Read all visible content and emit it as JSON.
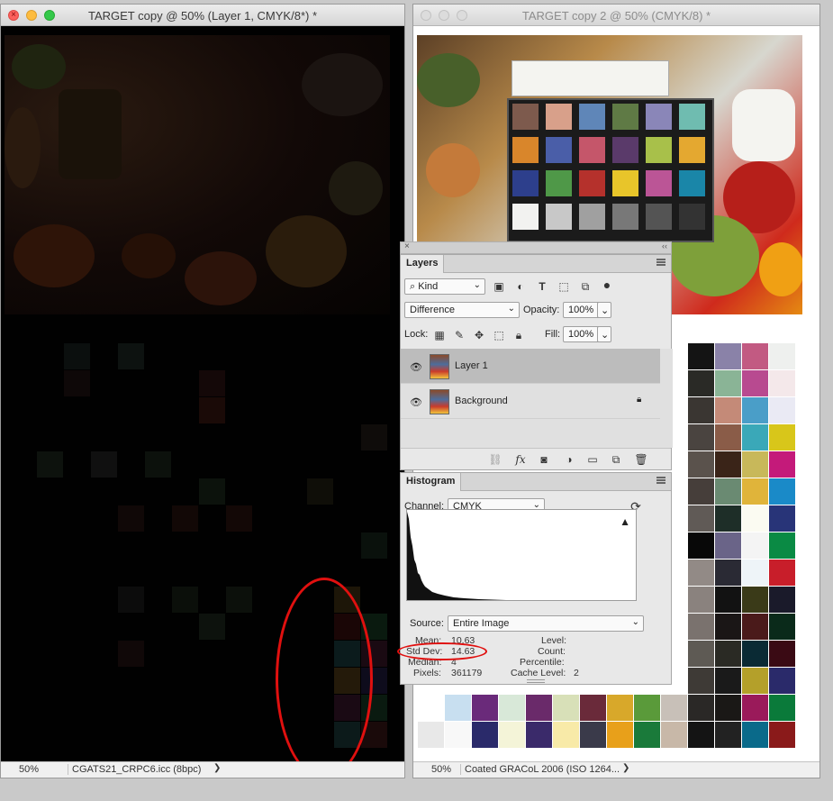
{
  "window1": {
    "title": "TARGET copy @ 50% (Layer 1, CMYK/8*) *",
    "zoom": "50%",
    "doc_info": "CGATS21_CRPC6.icc (8bpc)"
  },
  "window2": {
    "title": "TARGET copy 2 @ 50% (CMYK/8) *",
    "zoom": "50%",
    "doc_info": "Coated GRACoL 2006 (ISO 1264..."
  },
  "layers_panel": {
    "tab": "Layers",
    "kind_label": "Kind",
    "blend_mode": "Difference",
    "opacity_label": "Opacity:",
    "opacity_value": "100%",
    "lock_label": "Lock:",
    "fill_label": "Fill:",
    "fill_value": "100%",
    "layers": [
      {
        "name": "Layer 1",
        "selected": true,
        "locked": false
      },
      {
        "name": "Background",
        "selected": false,
        "locked": true
      }
    ],
    "fx_label": "fx"
  },
  "histogram_panel": {
    "tab": "Histogram",
    "channel_label": "Channel:",
    "channel_value": "CMYK",
    "source_label": "Source:",
    "source_value": "Entire Image",
    "stats": {
      "mean_label": "Mean:",
      "mean": "10.63",
      "stddev_label": "Std Dev:",
      "stddev": "14.63",
      "median_label": "Median:",
      "median": "4",
      "pixels_label": "Pixels:",
      "pixels": "361179",
      "level_label": "Level:",
      "count_label": "Count:",
      "percentile_label": "Percentile:",
      "cache_label": "Cache Level:",
      "cache": "2"
    }
  },
  "colors": {
    "annotation": "#e0100f",
    "selected_row": "#bcbcbc"
  }
}
